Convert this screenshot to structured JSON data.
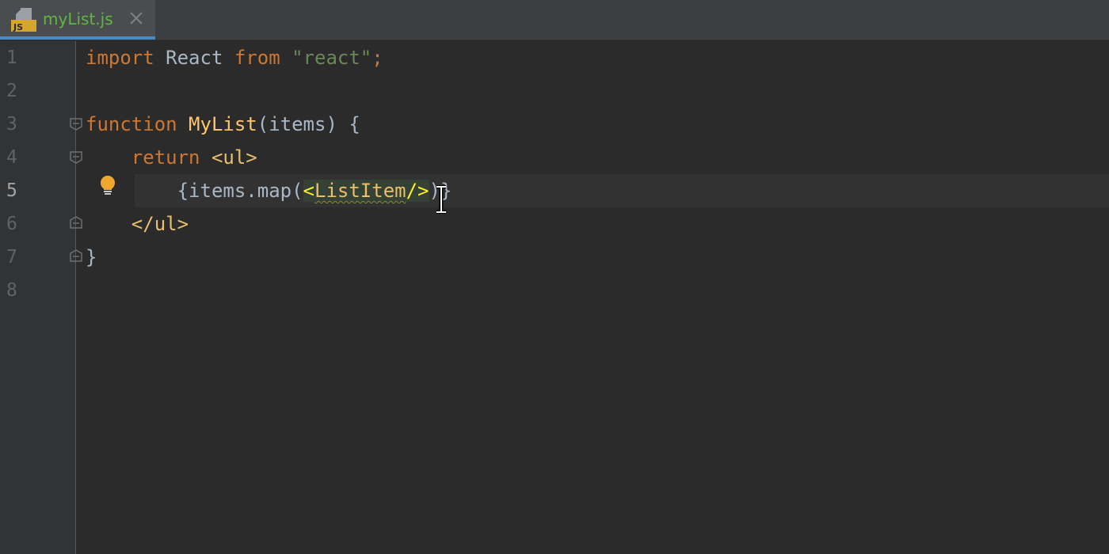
{
  "tab": {
    "filename": "myList.js",
    "file_icon": "js-file-icon",
    "icon_text": "JS",
    "close_icon": "close-icon"
  },
  "gutter": {
    "line_numbers": [
      "1",
      "2",
      "3",
      "4",
      "5",
      "6",
      "7",
      "8"
    ],
    "active_line": "5"
  },
  "code": {
    "line1": {
      "kw_import": "import",
      "name": " React ",
      "kw_from": "from",
      "space": " ",
      "str": "\"react\"",
      "semi": ";"
    },
    "line3": {
      "kw": "function",
      "space": " ",
      "fn": "MyList",
      "rest": "(items) {"
    },
    "line4": {
      "indent": "    ",
      "kw": "return",
      "space": " ",
      "tag": "<ul>"
    },
    "line5": {
      "indent": "        ",
      "pre": "{items.map(",
      "open": "<",
      "tagname": "ListItem",
      "close": "/>",
      "post": ")}"
    },
    "line6": {
      "indent": "    ",
      "tag": "</ul>"
    },
    "line7": {
      "brace": "}"
    }
  },
  "colors": {
    "keyword": "#cc7832",
    "string": "#6a8759",
    "function": "#ffc66d",
    "tag": "#e8bf6a",
    "text": "#a9b7c6",
    "background": "#2b2b2c"
  },
  "icons": [
    "js-file-icon",
    "close-icon",
    "fold-icon",
    "lightbulb-icon",
    "text-cursor-icon"
  ]
}
